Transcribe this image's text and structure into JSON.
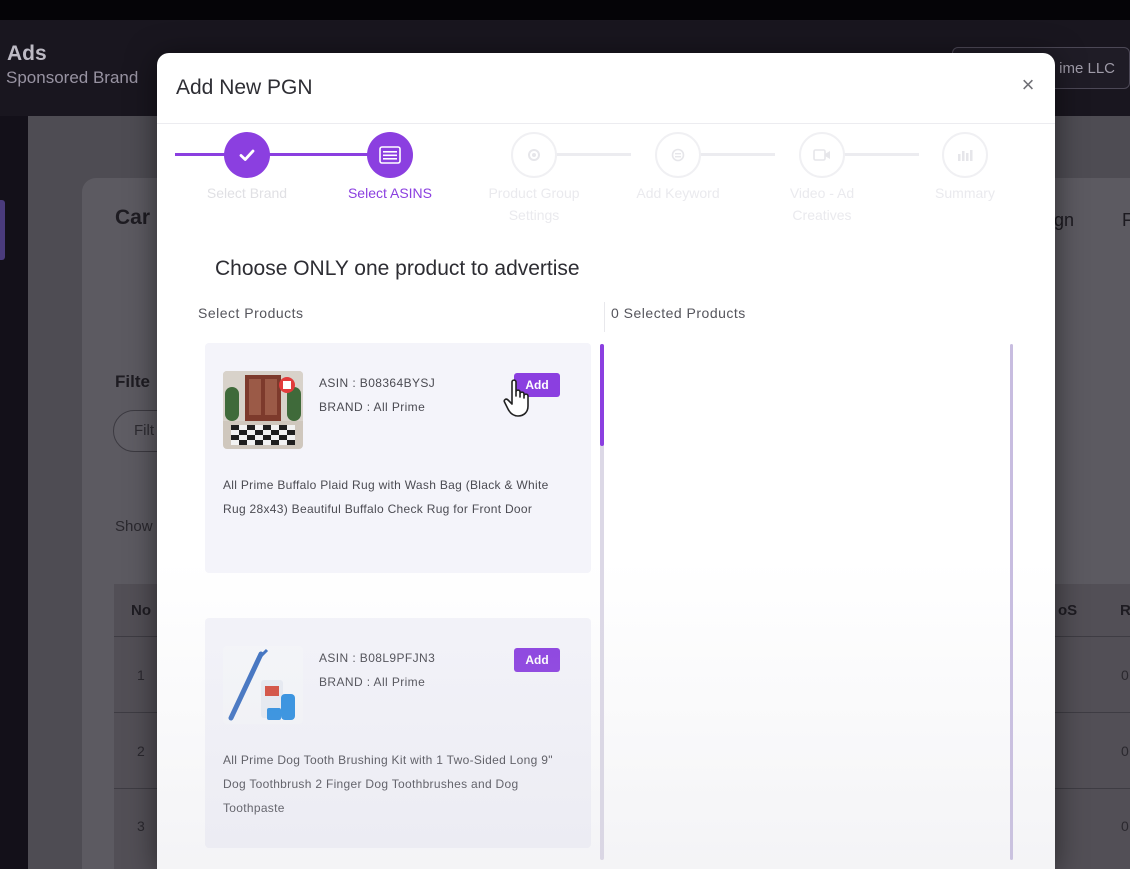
{
  "app": {
    "title": "Ads",
    "subtitle": "Sponsored Brand",
    "account": "ime LLC"
  },
  "background": {
    "card_title": "Car",
    "filter_label": "Filte",
    "filter_placeholder": "Filt",
    "show_label": "Show",
    "right_link_1": "aign",
    "right_link_2": "F",
    "table_header_no": "No",
    "table_header_roas": "oS",
    "table_header_r": "R",
    "rows": [
      "1",
      "2",
      "3"
    ],
    "row_values": [
      "0",
      "0",
      "0"
    ]
  },
  "modal": {
    "title": "Add New PGN",
    "close_symbol": "×",
    "steps": [
      {
        "label": "Select Brand",
        "state": "done",
        "icon": "check-icon"
      },
      {
        "label": "Select ASINS",
        "state": "current",
        "icon": "list-icon"
      },
      {
        "label": "Product Group Settings",
        "state": "todo",
        "icon": "gear-icon"
      },
      {
        "label": "Add Keyword",
        "state": "todo",
        "icon": "keyword-icon"
      },
      {
        "label": "Video - Ad Creatives",
        "state": "todo",
        "icon": "video-icon"
      },
      {
        "label": "Summary",
        "state": "todo",
        "icon": "chart-icon"
      }
    ],
    "heading": "Choose ONLY one product to advertise",
    "select_products_label": "Select Products",
    "selected_products_label": "0 Selected Products",
    "products": [
      {
        "asin": "ASIN : B08364BYSJ",
        "brand": "BRAND : All Prime",
        "add_label": "Add",
        "description": "All Prime Buffalo Plaid Rug with Wash Bag (Black & White Rug 28x43) Beautiful Buffalo Check Rug for Front Door",
        "image": "rug-door-image"
      },
      {
        "asin": "ASIN : B08L9PFJN3",
        "brand": "BRAND : All Prime",
        "add_label": "Add",
        "description": "All Prime Dog Tooth Brushing Kit with 1 Two-Sided Long 9\" Dog Toothbrush 2 Finger Dog Toothbrushes and Dog Toothpaste",
        "image": "toothbrush-kit-image"
      }
    ]
  },
  "colors": {
    "accent": "#8b3fe0",
    "overlay": "#4e4c53",
    "modal_bg": "#ffffff",
    "card_bg": "#f4f4fa"
  }
}
